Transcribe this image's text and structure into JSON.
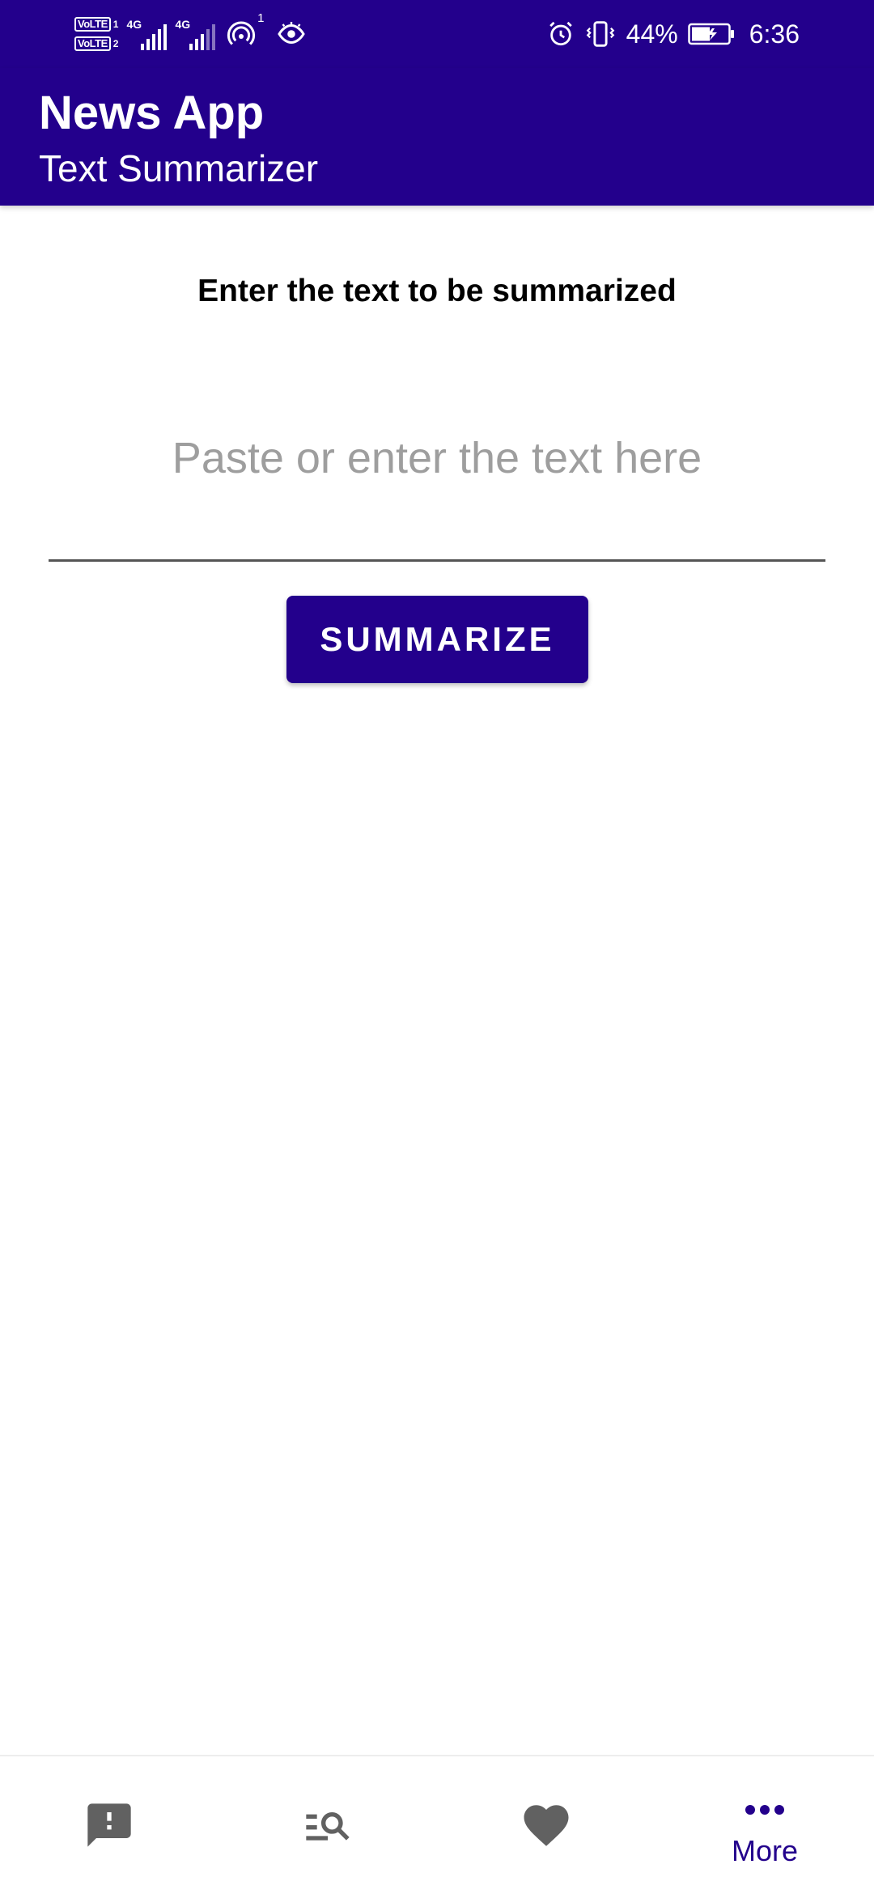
{
  "status_bar": {
    "sim1_label": "VoLTE",
    "sim1_num": "1",
    "sim2_label": "VoLTE",
    "sim2_num": "2",
    "net1": "4G",
    "net2": "4G",
    "hotspot_count": "1",
    "battery_percent": "44%",
    "time": "6:36"
  },
  "app_bar": {
    "title": "News App",
    "subtitle": "Text Summarizer"
  },
  "main": {
    "prompt": "Enter the text to be summarized",
    "input_value": "",
    "input_placeholder": "Paste or enter the text here",
    "summarize_label": "SUMMARIZE"
  },
  "bottom_nav": {
    "items": [
      {
        "icon": "feedback-icon",
        "label": ""
      },
      {
        "icon": "search-list-icon",
        "label": ""
      },
      {
        "icon": "heart-icon",
        "label": ""
      },
      {
        "icon": "more-dots-icon",
        "label": "More",
        "active": true
      }
    ]
  },
  "colors": {
    "primary": "#23008c",
    "inactive_icon": "#616161",
    "placeholder": "#9e9e9e"
  }
}
